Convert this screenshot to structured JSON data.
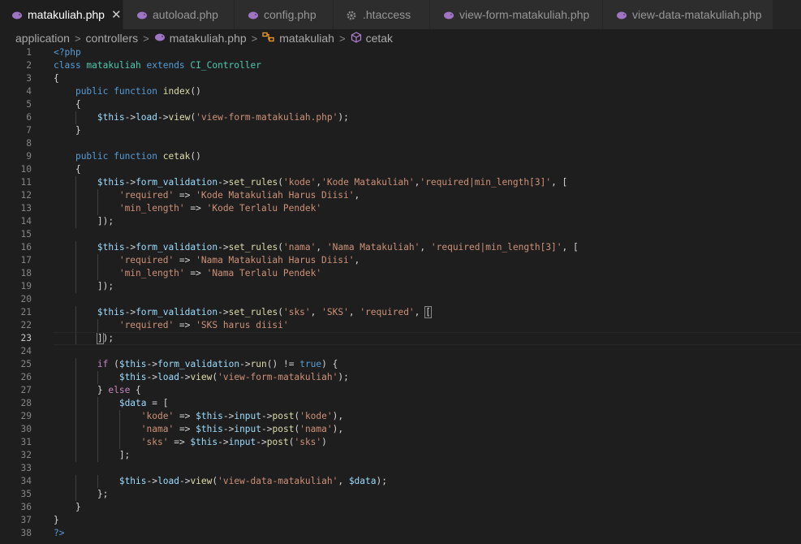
{
  "tabs": [
    {
      "label": "matakuliah.php",
      "active": true,
      "icon": "php-elephant-icon",
      "close": "✕"
    },
    {
      "label": "autoload.php",
      "active": false,
      "icon": "php-elephant-icon"
    },
    {
      "label": "config.php",
      "active": false,
      "icon": "php-elephant-icon"
    },
    {
      "label": ".htaccess",
      "active": false,
      "icon": "gear-icon"
    },
    {
      "label": "view-form-matakuliah.php",
      "active": false,
      "icon": "php-elephant-icon"
    },
    {
      "label": "view-data-matakuliah.php",
      "active": false,
      "icon": "php-elephant-icon"
    }
  ],
  "breadcrumb": {
    "items": [
      "application",
      "controllers",
      "matakuliah.php",
      "matakuliah",
      "cetak"
    ],
    "separator": ">"
  },
  "colors": {
    "background": "#1e1e1e",
    "keyword": "#569cd6",
    "class": "#4ec9b0",
    "function": "#dcdcaa",
    "variable": "#9cdcfe",
    "string": "#ce9178",
    "php_icon": "#a074c4"
  },
  "editor": {
    "current_line": 23,
    "lines": [
      [
        [
          "t-tag",
          "<?php"
        ]
      ],
      [
        [
          "t-kw",
          "class "
        ],
        [
          "t-cls",
          "matakuliah "
        ],
        [
          "t-kw",
          "extends "
        ],
        [
          "t-cls",
          "CI_Controller"
        ]
      ],
      [
        [
          "t-op",
          "{"
        ]
      ],
      [
        [
          "t-op",
          "    "
        ],
        [
          "t-kw",
          "public function "
        ],
        [
          "t-fn",
          "index"
        ],
        [
          "t-op",
          "()"
        ]
      ],
      [
        [
          "t-op",
          "    {"
        ]
      ],
      [
        [
          "t-op",
          "        "
        ],
        [
          "t-var",
          "$this"
        ],
        [
          "t-op",
          "->"
        ],
        [
          "t-var",
          "load"
        ],
        [
          "t-op",
          "->"
        ],
        [
          "t-fn",
          "view"
        ],
        [
          "t-op",
          "("
        ],
        [
          "t-str",
          "'view-form-matakuliah.php'"
        ],
        [
          "t-op",
          ");"
        ]
      ],
      [
        [
          "t-op",
          "    }"
        ]
      ],
      [],
      [
        [
          "t-op",
          "    "
        ],
        [
          "t-kw",
          "public function "
        ],
        [
          "t-fn",
          "cetak"
        ],
        [
          "t-op",
          "()"
        ]
      ],
      [
        [
          "t-op",
          "    {"
        ]
      ],
      [
        [
          "t-op",
          "        "
        ],
        [
          "t-var",
          "$this"
        ],
        [
          "t-op",
          "->"
        ],
        [
          "t-var",
          "form_validation"
        ],
        [
          "t-op",
          "->"
        ],
        [
          "t-fn",
          "set_rules"
        ],
        [
          "t-op",
          "("
        ],
        [
          "t-str",
          "'kode'"
        ],
        [
          "t-op",
          ","
        ],
        [
          "t-str",
          "'Kode Matakuliah'"
        ],
        [
          "t-op",
          ","
        ],
        [
          "t-str",
          "'required|min_length[3]'"
        ],
        [
          "t-op",
          ", ["
        ]
      ],
      [
        [
          "t-op",
          "            "
        ],
        [
          "t-str",
          "'required'"
        ],
        [
          "t-op",
          " => "
        ],
        [
          "t-str",
          "'Kode Matakuliah Harus Diisi'"
        ],
        [
          "t-op",
          ","
        ]
      ],
      [
        [
          "t-op",
          "            "
        ],
        [
          "t-str",
          "'min_length'"
        ],
        [
          "t-op",
          " => "
        ],
        [
          "t-str",
          "'Kode Terlalu Pendek'"
        ]
      ],
      [
        [
          "t-op",
          "        ]);"
        ]
      ],
      [],
      [
        [
          "t-op",
          "        "
        ],
        [
          "t-var",
          "$this"
        ],
        [
          "t-op",
          "->"
        ],
        [
          "t-var",
          "form_validation"
        ],
        [
          "t-op",
          "->"
        ],
        [
          "t-fn",
          "set_rules"
        ],
        [
          "t-op",
          "("
        ],
        [
          "t-str",
          "'nama'"
        ],
        [
          "t-op",
          ", "
        ],
        [
          "t-str",
          "'Nama Matakuliah'"
        ],
        [
          "t-op",
          ", "
        ],
        [
          "t-str",
          "'required|min_length[3]'"
        ],
        [
          "t-op",
          ", ["
        ]
      ],
      [
        [
          "t-op",
          "            "
        ],
        [
          "t-str",
          "'required'"
        ],
        [
          "t-op",
          " => "
        ],
        [
          "t-str",
          "'Nama Matakuliah Harus Diisi'"
        ],
        [
          "t-op",
          ","
        ]
      ],
      [
        [
          "t-op",
          "            "
        ],
        [
          "t-str",
          "'min_length'"
        ],
        [
          "t-op",
          " => "
        ],
        [
          "t-str",
          "'Nama Terlalu Pendek'"
        ]
      ],
      [
        [
          "t-op",
          "        ]);"
        ]
      ],
      [],
      [
        [
          "t-op",
          "        "
        ],
        [
          "t-var",
          "$this"
        ],
        [
          "t-op",
          "->"
        ],
        [
          "t-var",
          "form_validation"
        ],
        [
          "t-op",
          "->"
        ],
        [
          "t-fn",
          "set_rules"
        ],
        [
          "t-op",
          "("
        ],
        [
          "t-str",
          "'sks'"
        ],
        [
          "t-op",
          ", "
        ],
        [
          "t-str",
          "'SKS'"
        ],
        [
          "t-op",
          ", "
        ],
        [
          "t-str",
          "'required'"
        ],
        [
          "t-op",
          ", "
        ],
        [
          "bracket-hl",
          "["
        ]
      ],
      [
        [
          "t-op",
          "            "
        ],
        [
          "t-str",
          "'required'"
        ],
        [
          "t-op",
          " => "
        ],
        [
          "t-str",
          "'SKS harus diisi'"
        ]
      ],
      [
        [
          "t-op",
          "        "
        ],
        [
          "bracket-hl",
          "]"
        ],
        [
          "t-op",
          ");"
        ]
      ],
      [],
      [
        [
          "t-op",
          "        "
        ],
        [
          "t-ctl",
          "if "
        ],
        [
          "t-op",
          "("
        ],
        [
          "t-var",
          "$this"
        ],
        [
          "t-op",
          "->"
        ],
        [
          "t-var",
          "form_validation"
        ],
        [
          "t-op",
          "->"
        ],
        [
          "t-fn",
          "run"
        ],
        [
          "t-op",
          "() != "
        ],
        [
          "t-kw",
          "true"
        ],
        [
          "t-op",
          ") {"
        ]
      ],
      [
        [
          "t-op",
          "            "
        ],
        [
          "t-var",
          "$this"
        ],
        [
          "t-op",
          "->"
        ],
        [
          "t-var",
          "load"
        ],
        [
          "t-op",
          "->"
        ],
        [
          "t-fn",
          "view"
        ],
        [
          "t-op",
          "("
        ],
        [
          "t-str",
          "'view-form-matakuliah'"
        ],
        [
          "t-op",
          ");"
        ]
      ],
      [
        [
          "t-op",
          "        } "
        ],
        [
          "t-ctl",
          "else "
        ],
        [
          "t-op",
          "{"
        ]
      ],
      [
        [
          "t-op",
          "            "
        ],
        [
          "t-var",
          "$data"
        ],
        [
          "t-op",
          " = ["
        ]
      ],
      [
        [
          "t-op",
          "                "
        ],
        [
          "t-str",
          "'kode'"
        ],
        [
          "t-op",
          " => "
        ],
        [
          "t-var",
          "$this"
        ],
        [
          "t-op",
          "->"
        ],
        [
          "t-var",
          "input"
        ],
        [
          "t-op",
          "->"
        ],
        [
          "t-fn",
          "post"
        ],
        [
          "t-op",
          "("
        ],
        [
          "t-str",
          "'kode'"
        ],
        [
          "t-op",
          "),"
        ]
      ],
      [
        [
          "t-op",
          "                "
        ],
        [
          "t-str",
          "'nama'"
        ],
        [
          "t-op",
          " => "
        ],
        [
          "t-var",
          "$this"
        ],
        [
          "t-op",
          "->"
        ],
        [
          "t-var",
          "input"
        ],
        [
          "t-op",
          "->"
        ],
        [
          "t-fn",
          "post"
        ],
        [
          "t-op",
          "("
        ],
        [
          "t-str",
          "'nama'"
        ],
        [
          "t-op",
          "),"
        ]
      ],
      [
        [
          "t-op",
          "                "
        ],
        [
          "t-str",
          "'sks'"
        ],
        [
          "t-op",
          " => "
        ],
        [
          "t-var",
          "$this"
        ],
        [
          "t-op",
          "->"
        ],
        [
          "t-var",
          "input"
        ],
        [
          "t-op",
          "->"
        ],
        [
          "t-fn",
          "post"
        ],
        [
          "t-op",
          "("
        ],
        [
          "t-str",
          "'sks'"
        ],
        [
          "t-op",
          ")"
        ]
      ],
      [
        [
          "t-op",
          "            ];"
        ]
      ],
      [],
      [
        [
          "t-op",
          "            "
        ],
        [
          "t-var",
          "$this"
        ],
        [
          "t-op",
          "->"
        ],
        [
          "t-var",
          "load"
        ],
        [
          "t-op",
          "->"
        ],
        [
          "t-fn",
          "view"
        ],
        [
          "t-op",
          "("
        ],
        [
          "t-str",
          "'view-data-matakuliah'"
        ],
        [
          "t-op",
          ", "
        ],
        [
          "t-var",
          "$data"
        ],
        [
          "t-op",
          ");"
        ]
      ],
      [
        [
          "t-op",
          "        };"
        ]
      ],
      [
        [
          "t-op",
          "    }"
        ]
      ],
      [
        [
          "t-op",
          "}"
        ]
      ],
      [
        [
          "t-tag",
          "?>"
        ]
      ]
    ]
  }
}
